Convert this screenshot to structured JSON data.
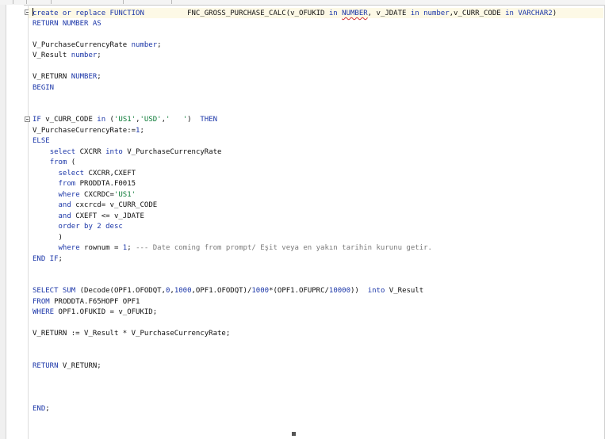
{
  "editor": {
    "code_lines": [
      [
        {
          "t": "create or replace FUNCTION",
          "c": "kw"
        },
        {
          "t": "          FNC_GROSS_PURCHASE_CALC(v_OFUKID "
        },
        {
          "t": "in",
          "c": "kw"
        },
        {
          "t": " "
        },
        {
          "t": "NUMBER",
          "c": "kw sq"
        },
        {
          "t": ", v_JDATE "
        },
        {
          "t": "in",
          "c": "kw"
        },
        {
          "t": " "
        },
        {
          "t": "number",
          "c": "kw"
        },
        {
          "t": ",v_CURR_CODE "
        },
        {
          "t": "in",
          "c": "kw"
        },
        {
          "t": " "
        },
        {
          "t": "VARCHAR2",
          "c": "kw"
        },
        {
          "t": ")"
        }
      ],
      [
        {
          "t": "RETURN NUMBER AS",
          "c": "kw"
        }
      ],
      [],
      [
        {
          "t": "V_PurchaseCurrencyRate "
        },
        {
          "t": "number",
          "c": "kw"
        },
        {
          "t": ";"
        }
      ],
      [
        {
          "t": "V_Result "
        },
        {
          "t": "number",
          "c": "kw"
        },
        {
          "t": ";"
        }
      ],
      [],
      [
        {
          "t": "V_RETURN "
        },
        {
          "t": "NUMBER",
          "c": "kw"
        },
        {
          "t": ";"
        }
      ],
      [
        {
          "t": "BEGIN",
          "c": "kw"
        }
      ],
      [],
      [],
      [
        {
          "t": "IF",
          "c": "kw"
        },
        {
          "t": " v_CURR_CODE "
        },
        {
          "t": "in",
          "c": "kw"
        },
        {
          "t": " ("
        },
        {
          "t": "'US1'",
          "c": "str"
        },
        {
          "t": ","
        },
        {
          "t": "'USD'",
          "c": "str"
        },
        {
          "t": ","
        },
        {
          "t": "'   '",
          "c": "str"
        },
        {
          "t": ")  "
        },
        {
          "t": "THEN",
          "c": "kw"
        }
      ],
      [
        {
          "t": "V_PurchaseCurrencyRate:="
        },
        {
          "t": "1",
          "c": "num"
        },
        {
          "t": ";"
        }
      ],
      [
        {
          "t": "ELSE",
          "c": "kw"
        }
      ],
      [
        {
          "t": "    "
        },
        {
          "t": "select",
          "c": "kw"
        },
        {
          "t": " CXCRR "
        },
        {
          "t": "into",
          "c": "kw"
        },
        {
          "t": " V_PurchaseCurrencyRate"
        }
      ],
      [
        {
          "t": "    "
        },
        {
          "t": "from",
          "c": "kw"
        },
        {
          "t": " ("
        }
      ],
      [
        {
          "t": "      "
        },
        {
          "t": "select",
          "c": "kw"
        },
        {
          "t": " CXCRR,CXEFT"
        }
      ],
      [
        {
          "t": "      "
        },
        {
          "t": "from",
          "c": "kw"
        },
        {
          "t": " PRODDTA.F0015"
        }
      ],
      [
        {
          "t": "      "
        },
        {
          "t": "where",
          "c": "kw"
        },
        {
          "t": " CXCRDC="
        },
        {
          "t": "'US1'",
          "c": "str"
        }
      ],
      [
        {
          "t": "      "
        },
        {
          "t": "and",
          "c": "kw"
        },
        {
          "t": " cxcrcd= v_CURR_CODE"
        }
      ],
      [
        {
          "t": "      "
        },
        {
          "t": "and",
          "c": "kw"
        },
        {
          "t": " CXEFT <= v_JDATE"
        }
      ],
      [
        {
          "t": "      "
        },
        {
          "t": "order by",
          "c": "kw"
        },
        {
          "t": " "
        },
        {
          "t": "2",
          "c": "num"
        },
        {
          "t": " "
        },
        {
          "t": "desc",
          "c": "kw"
        }
      ],
      [
        {
          "t": "      )"
        }
      ],
      [
        {
          "t": "      "
        },
        {
          "t": "where",
          "c": "kw"
        },
        {
          "t": " rownum = "
        },
        {
          "t": "1",
          "c": "num"
        },
        {
          "t": "; "
        },
        {
          "t": "--- Date coming from prompt/ Eşit veya en yakın tarihin kurunu getir.",
          "c": "cm"
        }
      ],
      [
        {
          "t": "END IF",
          "c": "kw"
        },
        {
          "t": ";"
        }
      ],
      [],
      [],
      [
        {
          "t": "SELECT SUM",
          "c": "kw"
        },
        {
          "t": " (Decode(OPF1.OFODQT,"
        },
        {
          "t": "0",
          "c": "num"
        },
        {
          "t": ","
        },
        {
          "t": "1000",
          "c": "num"
        },
        {
          "t": ",OPF1.OFODQT)/"
        },
        {
          "t": "1000",
          "c": "num"
        },
        {
          "t": "*(OPF1.OFUPRC/"
        },
        {
          "t": "10000",
          "c": "num"
        },
        {
          "t": "))  "
        },
        {
          "t": "into",
          "c": "kw"
        },
        {
          "t": " V_Result"
        }
      ],
      [
        {
          "t": "FROM",
          "c": "kw"
        },
        {
          "t": " PRODDTA.F65HOPF OPF1"
        }
      ],
      [
        {
          "t": "WHERE",
          "c": "kw"
        },
        {
          "t": " OPF1.OFUKID = v_OFUKID;"
        }
      ],
      [],
      [
        {
          "t": "V_RETURN := V_Result * V_PurchaseCurrencyRate;"
        }
      ],
      [],
      [],
      [
        {
          "t": "RETURN",
          "c": "kw"
        },
        {
          "t": " V_RETURN;"
        }
      ],
      [],
      [],
      [],
      [
        {
          "t": "END",
          "c": "kw"
        },
        {
          "t": ";"
        }
      ]
    ]
  }
}
